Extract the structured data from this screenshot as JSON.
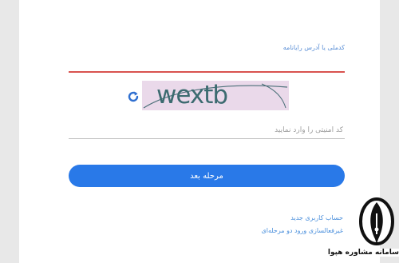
{
  "form": {
    "username_label": "کدملی یا آدرس رایانامه",
    "username_value": "",
    "captcha_text": "wextb",
    "security_placeholder": "کد امنیتی را وارد نمایید",
    "security_value": "",
    "submit_label": "مرحله بعد"
  },
  "links": {
    "create_account": "حساب کاربری جدید",
    "two_factor": "غیرفعالسازی ورود دو مرحله‌ای"
  },
  "brand": {
    "text": "سامانه مشاوره هپوا"
  },
  "colors": {
    "accent": "#2979e8",
    "error_underline": "#d9534f",
    "link": "#4a8fdc",
    "captcha_bg": "#ead9ea"
  },
  "icons": {
    "refresh": "refresh-icon",
    "logo": "pen-nib-logo"
  }
}
